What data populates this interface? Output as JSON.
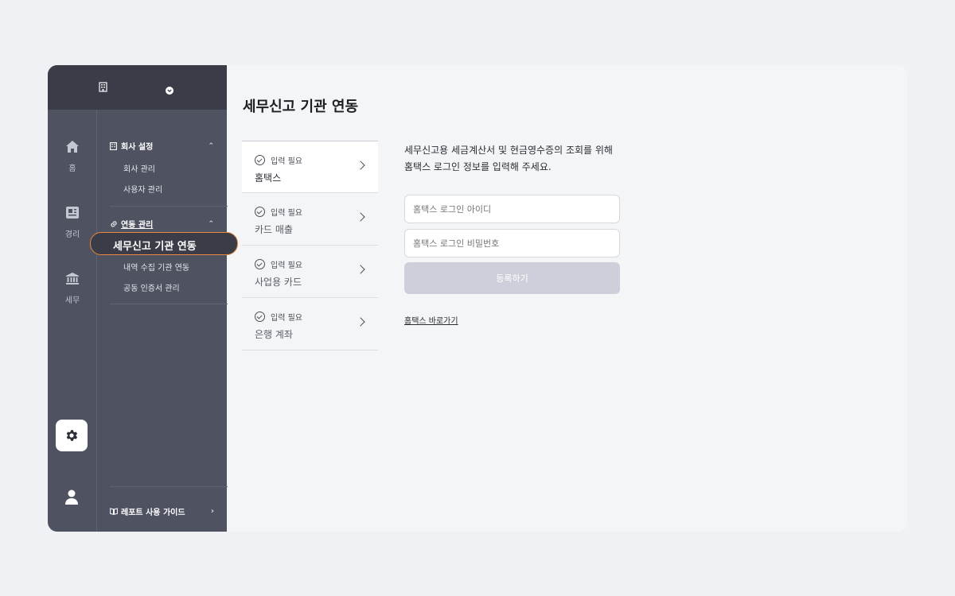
{
  "sidebar": {
    "rail": [
      {
        "label": "홈",
        "icon": "home-icon"
      },
      {
        "label": "경리",
        "icon": "ledger-icon"
      },
      {
        "label": "세무",
        "icon": "bank-icon"
      }
    ],
    "menu": {
      "company_section": "회사 설정",
      "company_items": [
        "회사 관리",
        "사용자 관리"
      ],
      "link_section": "연동 관리",
      "active_item": "세무신고 기관 연동",
      "link_items": [
        "내역 수집 기관 연동",
        "공동 인증서 관리"
      ],
      "guide": "레포트 사용 가이드"
    }
  },
  "main": {
    "title": "세무신고 기관 연동",
    "institutions": [
      {
        "status": "입력 필요",
        "name": "홈택스"
      },
      {
        "status": "입력 필요",
        "name": "카드 매출"
      },
      {
        "status": "입력 필요",
        "name": "사업용 카드"
      },
      {
        "status": "입력 필요",
        "name": "은행 계좌"
      }
    ],
    "description_line1": "세무신고용 세금계산서 및 현금영수증의 조회를 위해",
    "description_line2": "홈택스 로그인 정보를 입력해 주세요.",
    "id_placeholder": "홈택스 로그인 아이디",
    "pw_placeholder": "홈택스 로그인 비밀번호",
    "submit_label": "등록하기",
    "shortcut_link": "홈택스 바로가기"
  }
}
